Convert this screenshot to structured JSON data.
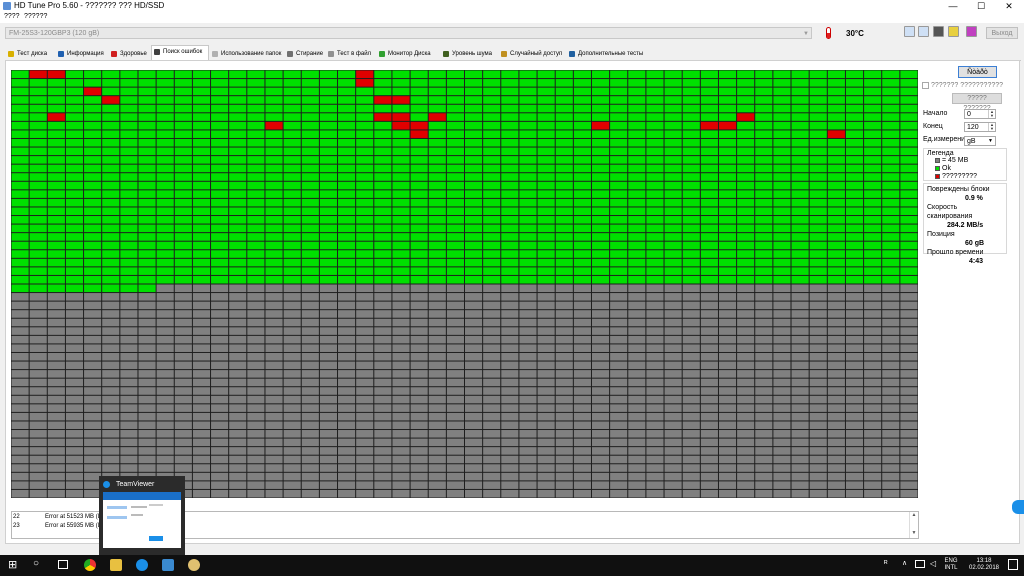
{
  "window": {
    "title": "HD Tune Pro 5.60 - ??????? ??? HD/SSD",
    "controls": [
      "—",
      "☐",
      "✕"
    ]
  },
  "menu": {
    "items": [
      "????",
      "??????"
    ]
  },
  "toolbar": {
    "drive": "FM-25S3-120GBP3 (120 gB)",
    "temperature": "30°C",
    "exit_label": "Выход",
    "icons": [
      "copy-icon",
      "copy-info-icon",
      "camera-icon",
      "key-icon",
      "save-icon"
    ]
  },
  "tabs": [
    {
      "label": "Тест диска",
      "icon": "lightbulb-icon",
      "color": "#d8b000"
    },
    {
      "label": "Информация",
      "icon": "info-icon",
      "color": "#2060b0"
    },
    {
      "label": "Здоровье",
      "icon": "health-cross-icon",
      "color": "#d02020"
    },
    {
      "label": "Поиск ошибок",
      "icon": "magnifier-icon",
      "color": "#404040",
      "active": true
    },
    {
      "label": "Использование папок",
      "icon": "folder-icon",
      "color": "#b0b0b0"
    },
    {
      "label": "Стирание",
      "icon": "trash-icon",
      "color": "#707070"
    },
    {
      "label": "Тест в файл",
      "icon": "file-icon",
      "color": "#909090"
    },
    {
      "label": "Монитор Диска",
      "icon": "monitor-icon",
      "color": "#30a030"
    },
    {
      "label": "Уровень шума",
      "icon": "speaker-icon",
      "color": "#406020"
    },
    {
      "label": "Случайный доступ",
      "icon": "random-icon",
      "color": "#c09020"
    },
    {
      "label": "Дополнительные тесты",
      "icon": "tools-icon",
      "color": "#2060a0"
    }
  ],
  "scan": {
    "columns": 50,
    "rows": 50,
    "completed_blocks": 1258,
    "damaged_blocks": [
      1,
      2,
      19,
      69,
      104,
      155,
      170,
      171,
      252,
      270,
      271,
      273,
      290,
      314,
      321,
      322,
      332,
      338,
      339,
      372,
      395
    ],
    "colors": {
      "ok": "#00e000",
      "damaged": "#e00000",
      "pending": "#808080",
      "grid": "#1e1e1e"
    }
  },
  "controls": {
    "start_button": "Ñòàðò",
    "checkbox_label": "??????? ???????????",
    "secondary_button": "????? ???????",
    "start_label": "Начало",
    "start_value": "0",
    "end_label": "Конец",
    "end_value": "120",
    "unit_label": "Ед.измерения",
    "unit_value": "gB"
  },
  "legend": {
    "title": "Легенда",
    "items": [
      {
        "label": "= 45 MB",
        "color": "#808080"
      },
      {
        "label": "Ok",
        "color": "#00e000"
      },
      {
        "label": "?????????",
        "color": "#e00000"
      }
    ]
  },
  "stats": {
    "damaged_label": "Повреждены блоки",
    "damaged_value": "0.9 %",
    "speed_label": "Скорость сканирования",
    "speed_value": "284.2 MB/s",
    "position_label": "Позиция",
    "position_value": "60 gB",
    "elapsed_label": "Прошло времени",
    "elapsed_value": "4:43"
  },
  "log": [
    {
      "n": "22",
      "text": "Error at 51523 MB (LE"
    },
    {
      "n": "23",
      "text": "Error at 55935 MB (LE"
    }
  ],
  "teamviewer": {
    "title": "TeamViewer"
  },
  "taskbar": {
    "apps": [
      "windows-start-icon",
      "search-icon",
      "task-view-icon",
      "chrome-icon",
      "file-explorer-icon",
      "teamviewer-icon",
      "monitor-app-icon",
      "hdtune-icon"
    ],
    "lang_top": "ENG",
    "lang_bottom": "INTL",
    "time": "13:18",
    "date": "02.02.2018"
  }
}
